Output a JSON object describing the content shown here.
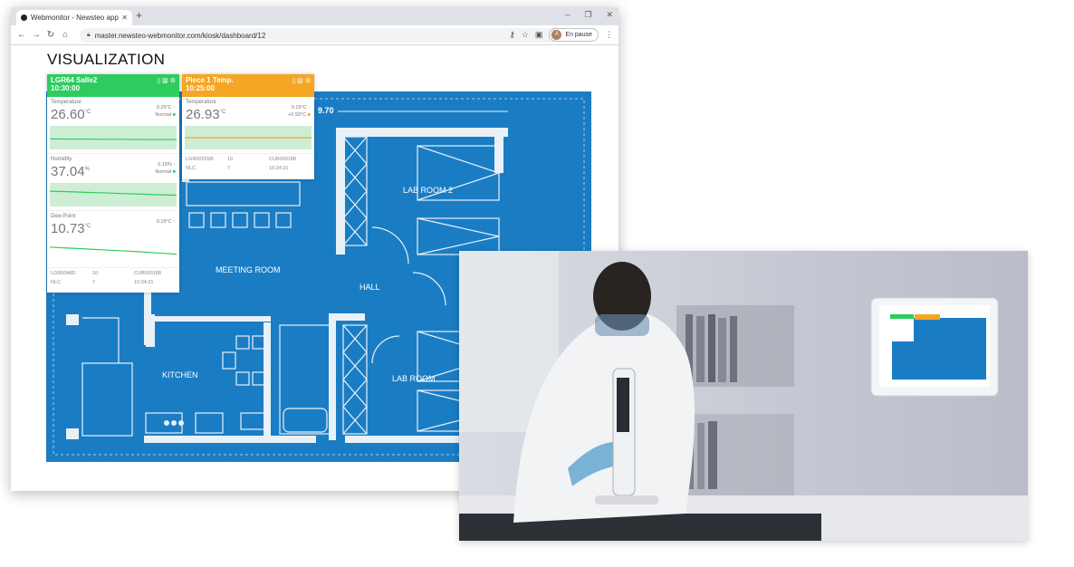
{
  "browser": {
    "tab_title": "Webmonitor - Newsteo applicati",
    "url": "master.newsteo-webmonitor.com/kiosk/dashboard/12",
    "profile_initial": "A",
    "profile_status": "En pause"
  },
  "page": {
    "title": "VISUALIZATION"
  },
  "plan": {
    "dimension": "9.70",
    "rooms": {
      "meeting": "MEETING ROOM",
      "hall": "HALL",
      "lab2": "LAB ROOM 2",
      "lab": "LAB ROOM",
      "kitchen": "KITCHEN"
    }
  },
  "sensor_a": {
    "name": "LGR64 Salle2",
    "time": "10:30:00",
    "header_color": "#2ecc5f",
    "metrics": [
      {
        "label": "Temperature",
        "value": "26.60",
        "unit": "°C",
        "delta": "0.25°C",
        "status": "Normal",
        "trend": [
          0.55,
          0.56,
          0.56,
          0.57,
          0.57,
          0.58,
          0.58,
          0.58
        ]
      },
      {
        "label": "Humidity",
        "value": "37.04",
        "unit": "%",
        "delta": "0.15%",
        "status": "Normal",
        "trend": [
          0.35,
          0.37,
          0.4,
          0.42,
          0.45,
          0.47,
          0.5,
          0.52
        ]
      },
      {
        "label": "Dew Point",
        "value": "10.73",
        "unit": "°C",
        "delta": "0.19°C",
        "status": "",
        "trend": [
          0.3,
          0.34,
          0.38,
          0.42,
          0.46,
          0.5,
          0.55,
          0.6
        ]
      }
    ],
    "footer": [
      "LGR0048D",
      "10",
      "CUB000188",
      "NLC",
      "7",
      "10:34:31"
    ]
  },
  "sensor_b": {
    "name": "Piece 1 Temp.",
    "time": "10:25:00",
    "header_color": "#f5a623",
    "metrics": [
      {
        "label": "Temperature",
        "value": "26.93",
        "unit": "°C",
        "delta": "0.15°C",
        "status": "+0.93°C",
        "trend": [
          0.5,
          0.5,
          0.5,
          0.5,
          0.5,
          0.5,
          0.5,
          0.5
        ]
      }
    ],
    "footer": [
      "LGR0025SB",
      "10",
      "CUB000188",
      "NLC",
      "7",
      "10:34:31"
    ]
  },
  "colors": {
    "plan_blue": "#1a7dc4",
    "green": "#2ecc5f",
    "orange": "#f5a623"
  }
}
